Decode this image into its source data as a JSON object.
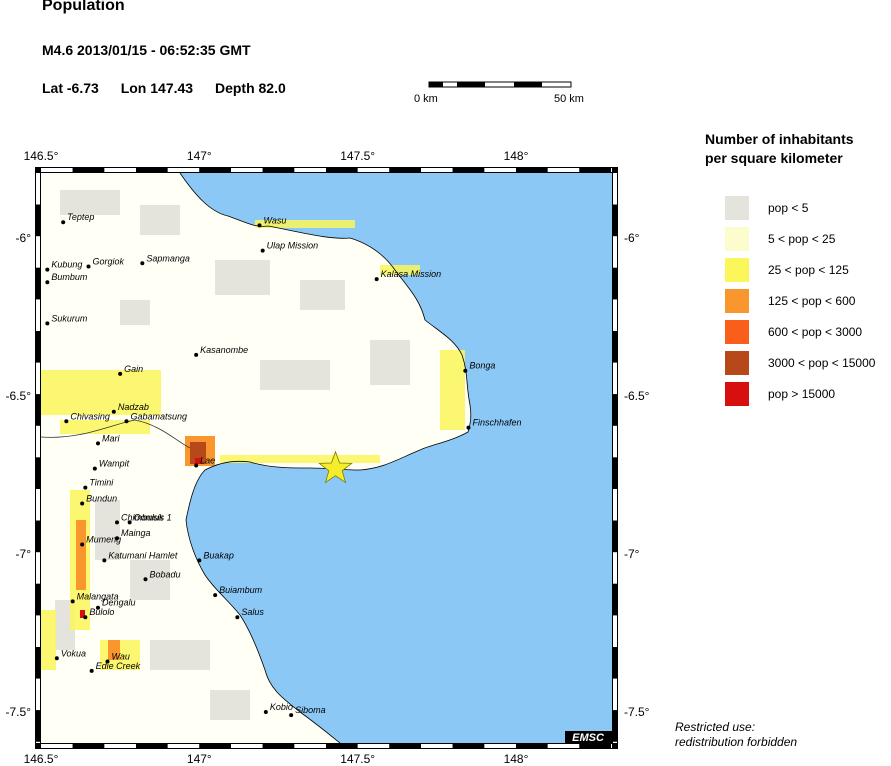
{
  "header": {
    "title": "Population",
    "event": "M4.6  2013/01/15 - 06:52:35 GMT",
    "lat": "Lat -6.73",
    "lon": "Lon 147.43",
    "depth": "Depth  82.0"
  },
  "scale_bar": {
    "left_label": "0 km",
    "right_label": "50 km"
  },
  "axes": {
    "lon_ticks": [
      "146.5°",
      "147°",
      "147.5°",
      "148°"
    ],
    "lat_ticks": [
      "-6°",
      "-6.5°",
      "-7°",
      "-7.5°"
    ]
  },
  "legend": {
    "title_line1": "Number of inhabitants",
    "title_line2": "per square kilometer",
    "items": [
      {
        "label": "pop < 5",
        "color": "#e4e4dc"
      },
      {
        "label": "5 < pop < 25",
        "color": "#fdfccc"
      },
      {
        "label": "25 < pop < 125",
        "color": "#fbf65a"
      },
      {
        "label": "125 < pop < 600",
        "color": "#f9962e"
      },
      {
        "label": "600 < pop < 3000",
        "color": "#f95f1b"
      },
      {
        "label": "3000 < pop < 15000",
        "color": "#b6481a"
      },
      {
        "label": "pop > 15000",
        "color": "#d70f0f"
      }
    ]
  },
  "epicenter": {
    "lat": -6.73,
    "lon": 147.43
  },
  "places": [
    {
      "name": "Teptep",
      "lon": 146.57,
      "lat": -5.95
    },
    {
      "name": "Wasu",
      "lon": 147.19,
      "lat": -5.96
    },
    {
      "name": "Ulap Mission",
      "lon": 147.2,
      "lat": -6.04
    },
    {
      "name": "Gorgiok",
      "lon": 146.65,
      "lat": -6.09
    },
    {
      "name": "Sapmanga",
      "lon": 146.82,
      "lat": -6.08
    },
    {
      "name": "Kalasa Mission",
      "lon": 147.56,
      "lat": -6.13
    },
    {
      "name": "Kubung",
      "lon": 146.52,
      "lat": -6.1
    },
    {
      "name": "Bumbum",
      "lon": 146.52,
      "lat": -6.14
    },
    {
      "name": "Sukurum",
      "lon": 146.52,
      "lat": -6.27
    },
    {
      "name": "Kasanombe",
      "lon": 146.99,
      "lat": -6.37
    },
    {
      "name": "Bonga",
      "lon": 147.84,
      "lat": -6.42
    },
    {
      "name": "Gain",
      "lon": 146.75,
      "lat": -6.43
    },
    {
      "name": "Nadzab",
      "lon": 146.73,
      "lat": -6.55
    },
    {
      "name": "Chivasing",
      "lon": 146.58,
      "lat": -6.58
    },
    {
      "name": "Gabamatsung",
      "lon": 146.77,
      "lat": -6.58
    },
    {
      "name": "Finschhafen",
      "lon": 147.85,
      "lat": -6.6
    },
    {
      "name": "Mari",
      "lon": 146.68,
      "lat": -6.65
    },
    {
      "name": "Lae",
      "lon": 146.99,
      "lat": -6.72
    },
    {
      "name": "Wampit",
      "lon": 146.67,
      "lat": -6.73
    },
    {
      "name": "Timini",
      "lon": 146.64,
      "lat": -6.79
    },
    {
      "name": "Bundun",
      "lon": 146.63,
      "lat": -6.84
    },
    {
      "name": "Chimbuluk",
      "lon": 146.74,
      "lat": -6.9
    },
    {
      "name": "Oomsis 1",
      "lon": 146.78,
      "lat": -6.9
    },
    {
      "name": "Mainga",
      "lon": 146.74,
      "lat": -6.95
    },
    {
      "name": "Mumeng",
      "lon": 146.63,
      "lat": -6.97
    },
    {
      "name": "Katumani Hamlet",
      "lon": 146.7,
      "lat": -7.02
    },
    {
      "name": "Buakap",
      "lon": 147.0,
      "lat": -7.02
    },
    {
      "name": "Bobadu",
      "lon": 146.83,
      "lat": -7.08
    },
    {
      "name": "Buiambum",
      "lon": 147.05,
      "lat": -7.13
    },
    {
      "name": "Malangata",
      "lon": 146.6,
      "lat": -7.15
    },
    {
      "name": "Dengalu",
      "lon": 146.68,
      "lat": -7.17
    },
    {
      "name": "Bulolo",
      "lon": 146.64,
      "lat": -7.2
    },
    {
      "name": "Salus",
      "lon": 147.12,
      "lat": -7.2
    },
    {
      "name": "Vokua",
      "lon": 146.55,
      "lat": -7.33
    },
    {
      "name": "Wau",
      "lon": 146.71,
      "lat": -7.34
    },
    {
      "name": "Edie Creek",
      "lon": 146.66,
      "lat": -7.37
    },
    {
      "name": "Kobio",
      "lon": 147.21,
      "lat": -7.5
    },
    {
      "name": "Siboma",
      "lon": 147.29,
      "lat": -7.51
    }
  ],
  "watermark": "EMSC",
  "restriction": {
    "line1": "Restricted use:",
    "line2": "redistribution forbidden"
  }
}
